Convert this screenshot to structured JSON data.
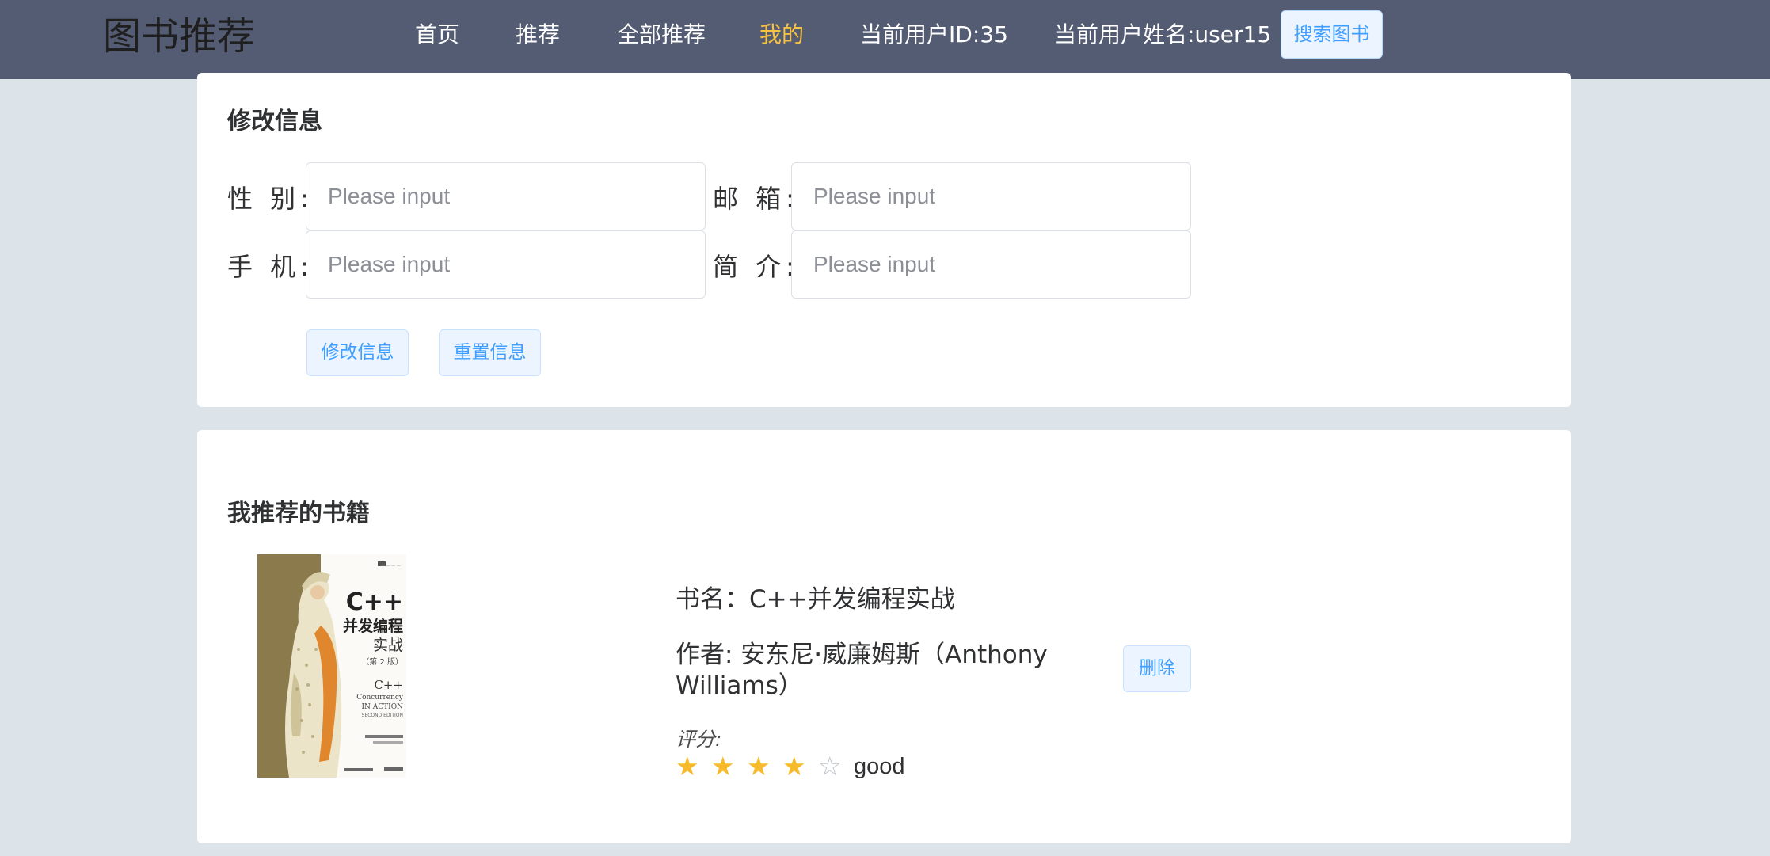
{
  "header": {
    "logo": "图书推荐",
    "nav": [
      {
        "label": "首页"
      },
      {
        "label": "推荐"
      },
      {
        "label": "全部推荐"
      },
      {
        "label": "我的"
      },
      {
        "label": "当前用户ID:35"
      },
      {
        "label": "当前用户姓名:user15"
      }
    ],
    "active_nav": "我的",
    "search_button": "搜索图书"
  },
  "profile_form": {
    "title": "修改信息",
    "fields": [
      {
        "label": "性 别:",
        "placeholder": "Please input",
        "value": ""
      },
      {
        "label": "邮 箱:",
        "placeholder": "Please input",
        "value": ""
      },
      {
        "label": "手 机:",
        "placeholder": "Please input",
        "value": ""
      },
      {
        "label": "简 介:",
        "placeholder": "Please input",
        "value": ""
      }
    ],
    "submit_label": "修改信息",
    "reset_label": "重置信息"
  },
  "my_books": {
    "title": "我推荐的书籍",
    "books": [
      {
        "name_line": "书名：C++并发编程实战",
        "author_line_1": "作者: 安东尼·威廉姆斯（Anthony",
        "author_line_2": "Williams）",
        "rating_label": "评分:",
        "rating_value": 4,
        "rating_max": 5,
        "rating_text": "good",
        "delete_label": "删除",
        "cover": {
          "title_en": "C++",
          "title_cn_1": "并发编程",
          "title_cn_2": "实战",
          "edition": "（第 2 版）",
          "subtitle_1": "C++",
          "subtitle_2": "Concurrency",
          "subtitle_3": "IN ACTION",
          "subtitle_4": "SECOND EDITION"
        }
      }
    ]
  },
  "colors": {
    "header_bg": "#545c73",
    "active": "#f5c242",
    "primary": "#409eff",
    "star": "#f7ba2a",
    "page_bg": "#dde4e9"
  }
}
